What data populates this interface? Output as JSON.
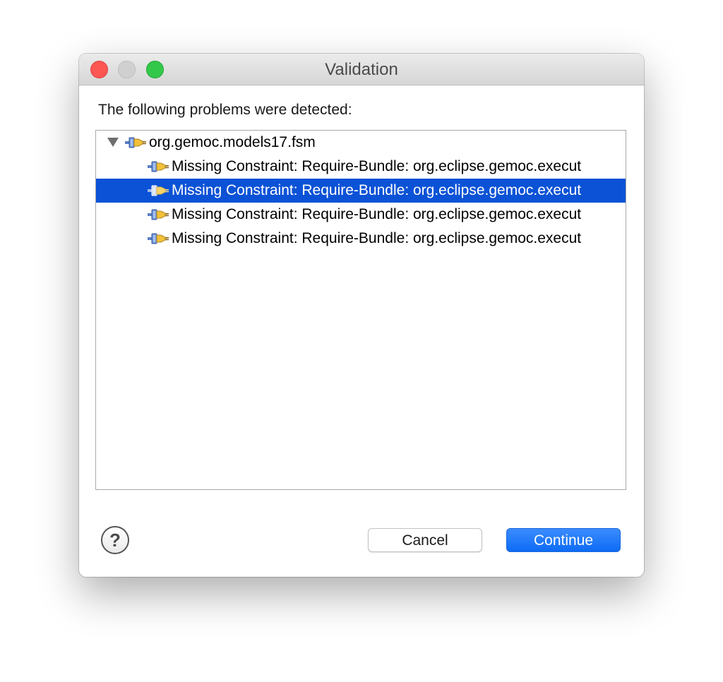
{
  "window": {
    "title": "Validation"
  },
  "dialog": {
    "prompt": "The following problems were detected:"
  },
  "tree": {
    "root": {
      "label": "org.gemoc.models17.fsm",
      "expanded": true,
      "icon": "plugin-icon"
    },
    "children": [
      {
        "label": "Missing Constraint: Require-Bundle: org.eclipse.gemoc.execut",
        "selected": false,
        "icon": "plugin-icon"
      },
      {
        "label": "Missing Constraint: Require-Bundle: org.eclipse.gemoc.execut",
        "selected": true,
        "icon": "plugin-icon"
      },
      {
        "label": "Missing Constraint: Require-Bundle: org.eclipse.gemoc.execut",
        "selected": false,
        "icon": "plugin-icon"
      },
      {
        "label": "Missing Constraint: Require-Bundle: org.eclipse.gemoc.execut",
        "selected": false,
        "icon": "plugin-icon"
      }
    ]
  },
  "buttons": {
    "help": "?",
    "cancel": "Cancel",
    "continue": "Continue"
  },
  "colors": {
    "selection": "#0b52d6",
    "primary_button": "#1472f8",
    "close": "#fc5753",
    "minimize": "#d0d0d0",
    "zoom": "#34c84a"
  }
}
